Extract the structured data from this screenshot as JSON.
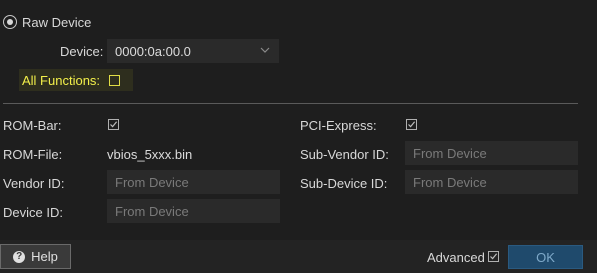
{
  "raw_device": {
    "label": "Raw Device",
    "selected": true
  },
  "device": {
    "label": "Device:",
    "value": "0000:0a:00.0"
  },
  "all_functions": {
    "label": "All Functions:",
    "checked": false
  },
  "rom_bar": {
    "label": "ROM-Bar:",
    "checked": true
  },
  "pci_express": {
    "label": "PCI-Express:",
    "checked": true
  },
  "rom_file": {
    "label": "ROM-File:",
    "value": "vbios_5xxx.bin"
  },
  "sub_vendor_id": {
    "label": "Sub-Vendor ID:",
    "placeholder": "From Device"
  },
  "vendor_id": {
    "label": "Vendor ID:",
    "placeholder": "From Device"
  },
  "sub_device_id": {
    "label": "Sub-Device ID:",
    "placeholder": "From Device"
  },
  "device_id": {
    "label": "Device ID:",
    "placeholder": "From Device"
  },
  "footer": {
    "help_label": "Help",
    "advanced_label": "Advanced",
    "advanced_checked": true,
    "ok_label": "OK"
  },
  "colors": {
    "background": "#1e1e1e",
    "highlight_text": "#f3f04a",
    "ok_button": "#1f4a6c"
  }
}
